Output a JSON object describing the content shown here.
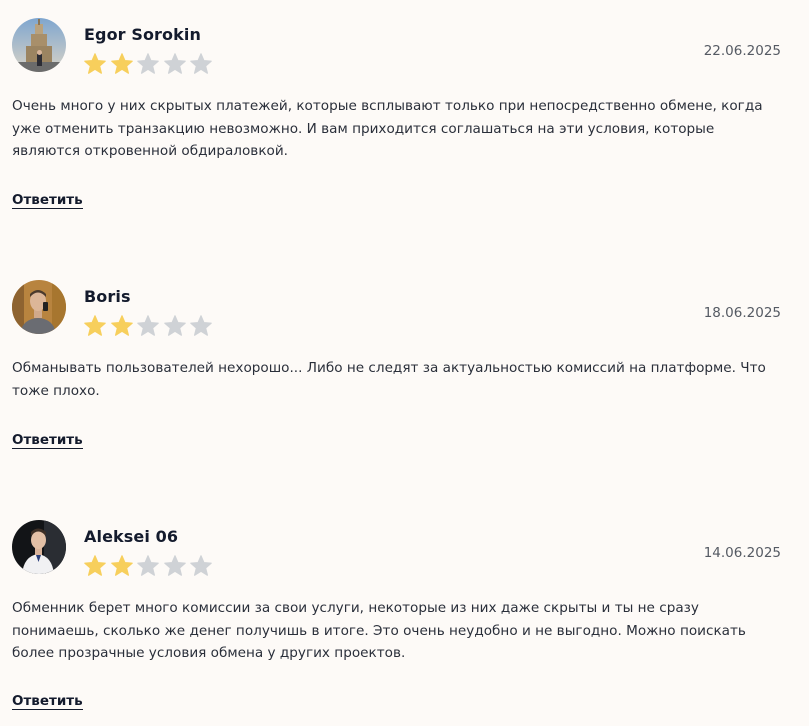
{
  "reviews": [
    {
      "author": "Egor Sorokin",
      "avatar_icon": "user-photo-tower",
      "date": "22.06.2025",
      "rating": 2,
      "rating_max": 5,
      "text": "Очень много у них скрытых платежей, которые всплывают только при непосредственно обмене, когда уже отменить транзакцию невозможно. И вам приходится соглашаться на эти условия, которые являются откровенной обдираловкой.",
      "reply_label": "Ответить"
    },
    {
      "author": "Boris",
      "avatar_icon": "user-photo-man",
      "date": "18.06.2025",
      "rating": 2,
      "rating_max": 5,
      "text": "Обманывать пользователей нехорошо... Либо не следят за актуальностью комиссий на платформе. Что тоже плохо.",
      "reply_label": "Ответить"
    },
    {
      "author": "Aleksei 06",
      "avatar_icon": "user-photo-man-dark",
      "date": "14.06.2025",
      "rating": 2,
      "rating_max": 5,
      "text": "Обменник берет много комиссии за свои услуги, некоторые из них даже скрыты и ты не сразу понимаешь, сколько же денег получишь в итоге. Это очень неудобно и не выгодно. Можно поискать более прозрачные условия обмена у других проектов.",
      "reply_label": "Ответить"
    }
  ],
  "colors": {
    "star_filled": "#f7cf5c",
    "star_empty": "#cfd2d6",
    "background": "#fdfaf7"
  }
}
